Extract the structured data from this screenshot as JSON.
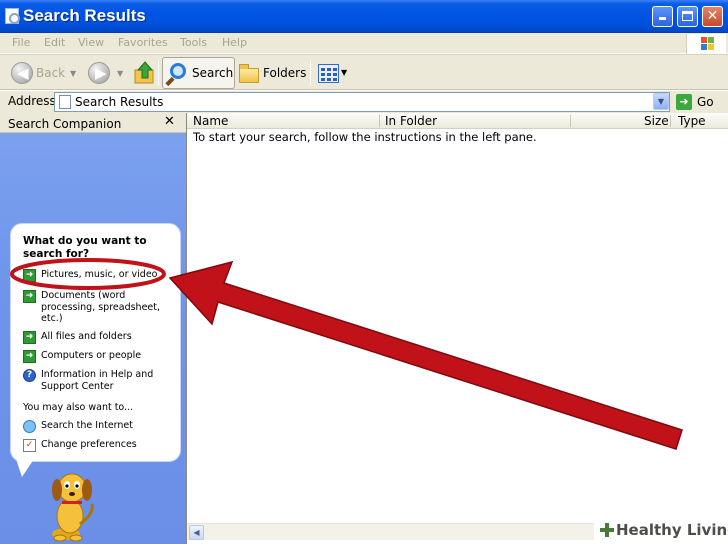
{
  "window": {
    "title": "Search Results",
    "icon": "search-results-window-icon"
  },
  "menu": [
    "File",
    "Edit",
    "View",
    "Favorites",
    "Tools",
    "Help"
  ],
  "toolbar": {
    "back_label": "Back",
    "search_label": "Search",
    "folders_label": "Folders"
  },
  "address": {
    "label": "Address",
    "value": "Search Results",
    "go_label": "Go"
  },
  "left_pane": {
    "title": "Search Companion",
    "question": "What do you want to search for?",
    "options": [
      {
        "label": "Pictures, music, or video",
        "icon": "green-arrow-icon"
      },
      {
        "label": "Documents (word processing, spreadsheet, etc.)",
        "icon": "green-arrow-icon"
      },
      {
        "label": "All files and folders",
        "icon": "green-arrow-icon"
      },
      {
        "label": "Computers or people",
        "icon": "green-arrow-icon"
      },
      {
        "label": "Information in Help and Support Center",
        "icon": "help-icon"
      }
    ],
    "also_label": "You may also want to...",
    "also_options": [
      {
        "label": "Search the Internet",
        "icon": "internet-search-icon"
      },
      {
        "label": "Change preferences",
        "icon": "preferences-icon"
      }
    ]
  },
  "results": {
    "columns": [
      "Name",
      "In Folder",
      "Size",
      "Type"
    ],
    "instruction": "To start your search, follow the instructions in the left pane."
  },
  "annotation": {
    "color": "#c1121a",
    "highlight_target": "Pictures, music, or video"
  },
  "watermark": {
    "text": "Healthy Living"
  },
  "colors": {
    "titlebar": "#0054e3",
    "left_pane_bg": "#6e95eb",
    "menu_disabled": "#a7a492"
  }
}
